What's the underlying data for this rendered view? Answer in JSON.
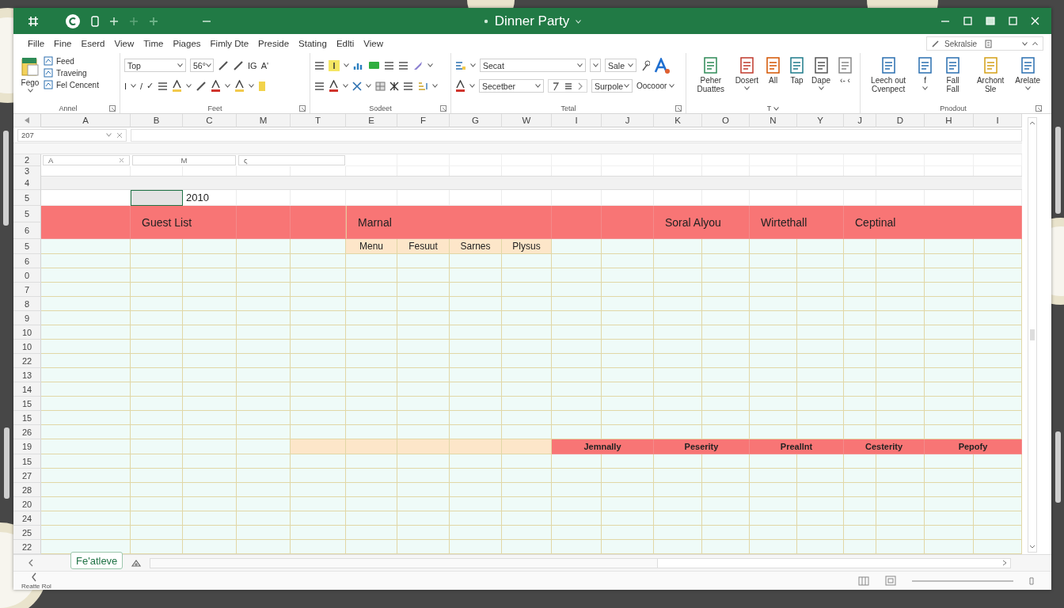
{
  "window": {
    "title": "Dinner Party"
  },
  "menu": [
    {
      "label": "Fille"
    },
    {
      "label": "Fine"
    },
    {
      "label": "Eserd"
    },
    {
      "label": "View"
    },
    {
      "label": "Time"
    },
    {
      "label": "Piages"
    },
    {
      "label": "Fimly Dte"
    },
    {
      "label": "Preside"
    },
    {
      "label": "Stating"
    },
    {
      "label": "Edlti"
    },
    {
      "label": "View"
    }
  ],
  "account": {
    "label": "Sekralsie"
  },
  "ribbon": {
    "groups": [
      {
        "kind": "clipboard",
        "label": "Annel",
        "big": {
          "label": "Fego",
          "dropdown": true
        },
        "items": [
          "Feed",
          "Traveing",
          "Fel Cencent"
        ]
      },
      {
        "kind": "font",
        "label": "Feet",
        "font": "Top",
        "size": "56°",
        "glyphs": [
          "IG",
          "A'",
          "I",
          "/",
          "✓"
        ]
      },
      {
        "kind": "tools",
        "label": "Sodeet"
      },
      {
        "kind": "fields",
        "label": "Tetal",
        "fields": [
          "Secat",
          "Sale",
          "Secetber",
          "Surpole"
        ],
        "button": "Oocooor"
      },
      {
        "kind": "buttons",
        "label": "T",
        "label_dropdown": true,
        "items": [
          {
            "label": "Peher Duattes",
            "dropdown": false
          },
          {
            "label": "Dosert",
            "dropdown": true
          },
          {
            "label": "All",
            "dropdown": false
          },
          {
            "label": "Tap",
            "dropdown": false
          },
          {
            "label": "Dape",
            "dropdown": true
          },
          {
            "label": "‹- ‹",
            "dropdown": false
          }
        ]
      },
      {
        "kind": "buttons",
        "label": "Pnodout",
        "label_dropdown": false,
        "items": [
          {
            "label": "Leech out Cvenpect",
            "dropdown": false
          },
          {
            "label": "f",
            "dropdown": true
          },
          {
            "label": "Fall Fall",
            "dropdown": false
          },
          {
            "label": "Archont Sle",
            "dropdown": false
          },
          {
            "label": "Arelate",
            "dropdown": true
          }
        ]
      }
    ]
  },
  "name_box": "207",
  "columns": [
    "A",
    "B",
    "C",
    "M",
    "T",
    "E",
    "F",
    "G",
    "W",
    "I",
    "J",
    "K",
    "O",
    "N",
    "Y",
    "J",
    "D",
    "H",
    "I"
  ],
  "rows": [
    {
      "kind": "inputs",
      "number": "2",
      "fields": [
        "A",
        "M",
        "ς"
      ]
    },
    {
      "kind": "blank",
      "number": "3"
    },
    {
      "kind": "band",
      "number": "4"
    },
    {
      "kind": "entry",
      "number": "5",
      "selected": true,
      "value": "2010"
    },
    {
      "kind": "title",
      "numbers": [
        "5",
        "6"
      ],
      "labels": [
        "Guest List",
        "Marnal",
        "Soral Alyou",
        "Wirtethall",
        "Ceptinal"
      ]
    },
    {
      "kind": "subhead",
      "number": "5",
      "labels": [
        "Menu",
        "Fesuut",
        "Sarnes",
        "Plysus"
      ]
    },
    {
      "kind": "empty",
      "number": "6"
    },
    {
      "kind": "empty",
      "number": "0"
    },
    {
      "kind": "empty",
      "number": "7"
    },
    {
      "kind": "empty",
      "number": "8"
    },
    {
      "kind": "empty",
      "number": "9"
    },
    {
      "kind": "empty",
      "number": "10"
    },
    {
      "kind": "empty",
      "number": "10"
    },
    {
      "kind": "empty",
      "number": "22"
    },
    {
      "kind": "empty",
      "number": "13"
    },
    {
      "kind": "empty",
      "number": "14"
    },
    {
      "kind": "empty",
      "number": "15"
    },
    {
      "kind": "empty",
      "number": "15"
    },
    {
      "kind": "empty",
      "number": "26"
    },
    {
      "kind": "totals",
      "number": "19",
      "labels": [
        "Jemnally",
        "Peserity",
        "Preallnt",
        "Cesterity",
        "Pepofy"
      ]
    },
    {
      "kind": "empty",
      "number": "15"
    },
    {
      "kind": "empty",
      "number": "27"
    },
    {
      "kind": "empty",
      "number": "28"
    },
    {
      "kind": "empty",
      "number": "20"
    },
    {
      "kind": "empty",
      "number": "24"
    },
    {
      "kind": "empty",
      "number": "25"
    },
    {
      "kind": "empty",
      "number": "22"
    }
  ],
  "sheets": [
    {
      "label": "Fe'atleve",
      "selected": true
    }
  ],
  "status_bar": {
    "text": "Reatte Rol",
    "zoom": {
      "level": 1
    }
  }
}
